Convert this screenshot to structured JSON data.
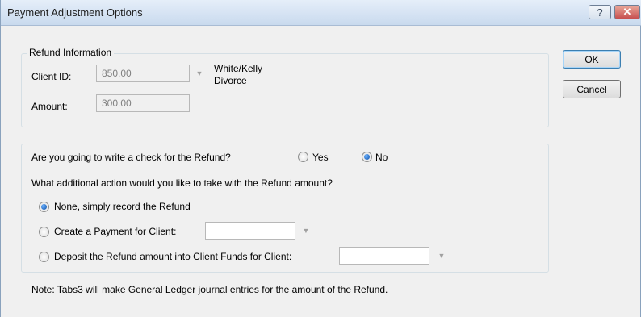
{
  "window": {
    "title": "Payment Adjustment Options",
    "help_label": "?",
    "close_label": "✕"
  },
  "buttons": {
    "ok": "OK",
    "cancel": "Cancel"
  },
  "refund_info": {
    "legend": "Refund Information",
    "client_id_label": "Client ID:",
    "client_id_value": "850.00",
    "client_name_line1": "White/Kelly",
    "client_name_line2": "Divorce",
    "amount_label": "Amount:",
    "amount_value": "300.00"
  },
  "options": {
    "question_check": "Are you going to write a check for the Refund?",
    "yes_label": "Yes",
    "no_label": "No",
    "check_selected": "No",
    "question_action": "What additional action would you like to take with the Refund amount?",
    "opt_none": "None, simply record the Refund",
    "opt_payment": "Create a Payment for Client:",
    "opt_deposit": "Deposit the Refund amount into Client Funds for Client:",
    "action_selected": "None, simply record the Refund",
    "payment_client_value": "",
    "deposit_client_value": ""
  },
  "note": "Note:  Tabs3 will make General Ledger journal entries for the amount of the Refund.",
  "icons": {
    "dropdown": "chevron-down-icon"
  }
}
